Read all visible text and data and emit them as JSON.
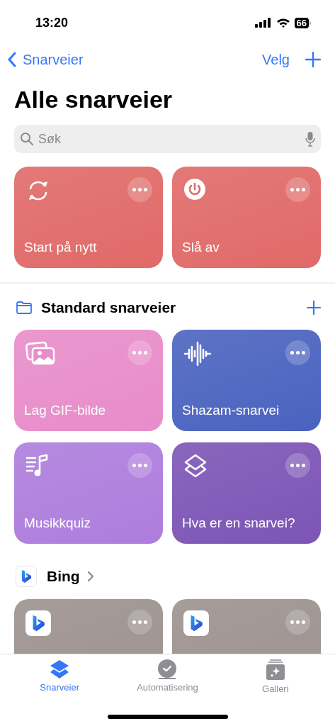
{
  "status_bar": {
    "time": "13:20",
    "battery": "66"
  },
  "nav": {
    "back": "Snarveier",
    "select": "Velg"
  },
  "title": "Alle snarveier",
  "search": {
    "placeholder": "Søk"
  },
  "top_shortcuts": [
    {
      "label": "Start på nytt",
      "kind": "refresh",
      "color": "#e06a68"
    },
    {
      "label": "Slå av",
      "kind": "power",
      "color": "#e06a68"
    }
  ],
  "folder": {
    "title": "Standard snarveier",
    "shortcuts": [
      {
        "label": "Lag GIF-bilde",
        "kind": "photos",
        "color": "#e88cca"
      },
      {
        "label": "Shazam-snarvei",
        "kind": "wave",
        "color": "#4a63bf"
      },
      {
        "label": "Musikkquiz",
        "kind": "music",
        "color": "#ae7ddd"
      },
      {
        "label": "Hva er en snarvei?",
        "kind": "layers",
        "color": "#7d55b6"
      }
    ]
  },
  "app_section": {
    "title": "Bing",
    "shortcuts": [
      {
        "kind": "bing",
        "color": "#9c928f"
      },
      {
        "kind": "bing",
        "color": "#9c928f"
      }
    ]
  },
  "tabs": [
    {
      "label": "Snarveier",
      "kind": "layers",
      "selected": true
    },
    {
      "label": "Automatisering",
      "kind": "clock",
      "selected": false
    },
    {
      "label": "Galleri",
      "kind": "gallery",
      "selected": false
    }
  ]
}
